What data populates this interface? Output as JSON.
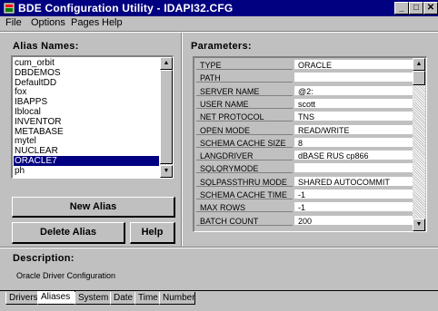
{
  "window": {
    "title": "BDE Configuration Utility - IDAPI32.CFG",
    "minimize": "_",
    "maximize": "□",
    "close": "✕"
  },
  "menu": {
    "file": "File",
    "options": "Options",
    "pages": "Pages",
    "help": "Help"
  },
  "alias_panel": {
    "label": "Alias Names:",
    "items": [
      "cum_orbit",
      "DBDEMOS",
      "DefaultDD",
      "fox",
      "IBAPPS",
      "Iblocal",
      "INVENTOR",
      "METABASE",
      "mytel",
      "NUCLEAR",
      "ORACLE7",
      "ph"
    ],
    "selected": "ORACLE7",
    "new_alias_button": "New Alias",
    "delete_alias_button": "Delete Alias",
    "help_button": "Help"
  },
  "parameters_panel": {
    "label": "Parameters:",
    "rows": [
      {
        "name": "TYPE",
        "value": "ORACLE"
      },
      {
        "name": "PATH",
        "value": ""
      },
      {
        "name": "SERVER NAME",
        "value": "@2:"
      },
      {
        "name": "USER NAME",
        "value": "scott"
      },
      {
        "name": "NET PROTOCOL",
        "value": "TNS"
      },
      {
        "name": "OPEN MODE",
        "value": "READ/WRITE"
      },
      {
        "name": "SCHEMA CACHE SIZE",
        "value": "8"
      },
      {
        "name": "LANGDRIVER",
        "value": "dBASE RUS cp866"
      },
      {
        "name": "SQLQRYMODE",
        "value": ""
      },
      {
        "name": "SQLPASSTHRU MODE",
        "value": "SHARED AUTOCOMMIT"
      },
      {
        "name": "SCHEMA CACHE TIME",
        "value": "-1"
      },
      {
        "name": "MAX ROWS",
        "value": "-1"
      },
      {
        "name": "BATCH COUNT",
        "value": "200"
      }
    ]
  },
  "description": {
    "label": "Description:",
    "text": "Oracle Driver Configuration"
  },
  "tabs": [
    "Drivers",
    "Aliases",
    "System",
    "Date",
    "Time",
    "Number"
  ],
  "active_tab": "Aliases"
}
